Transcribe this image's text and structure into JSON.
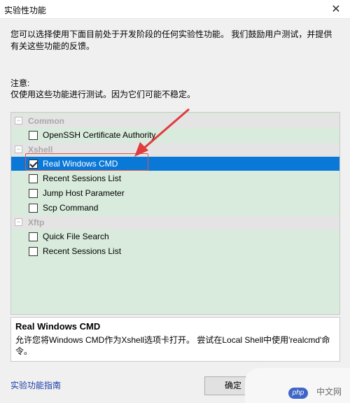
{
  "window": {
    "title": "实验性功能",
    "close_glyph": "✕"
  },
  "description": "您可以选择使用下面目前处于开发阶段的任何实验性功能。 我们鼓励用户测试，并提供有关这些功能的反馈。",
  "note": {
    "label": "注意:",
    "text": "仅使用这些功能进行测试。因为它们可能不稳定。"
  },
  "tree": {
    "groups": [
      {
        "label": "Common",
        "toggle": "−",
        "items": [
          {
            "label": "OpenSSH Certificate Authority",
            "checked": false
          }
        ]
      },
      {
        "label": "Xshell",
        "toggle": "−",
        "items": [
          {
            "label": "Real Windows CMD",
            "checked": true,
            "selected": true
          },
          {
            "label": "Recent Sessions List",
            "checked": false
          },
          {
            "label": "Jump Host Parameter",
            "checked": false
          },
          {
            "label": "Scp Command",
            "checked": false
          }
        ]
      },
      {
        "label": "Xftp",
        "toggle": "−",
        "items": [
          {
            "label": "Quick File Search",
            "checked": false
          },
          {
            "label": "Recent Sessions List",
            "checked": false
          }
        ]
      }
    ]
  },
  "info": {
    "title": "Real Windows CMD",
    "description": "允许您将Windows CMD作为Xshell选项卡打开。 尝试在Local Shell中使用'realcmd'命令。"
  },
  "footer": {
    "guide_link": "实验功能指南",
    "ok_label": "确定"
  },
  "watermark": {
    "badge": "php",
    "text": "中文网"
  },
  "colors": {
    "tree_background": "#d8ebdc",
    "selected_row": "#0a78d7",
    "annotation": "#e05252"
  }
}
